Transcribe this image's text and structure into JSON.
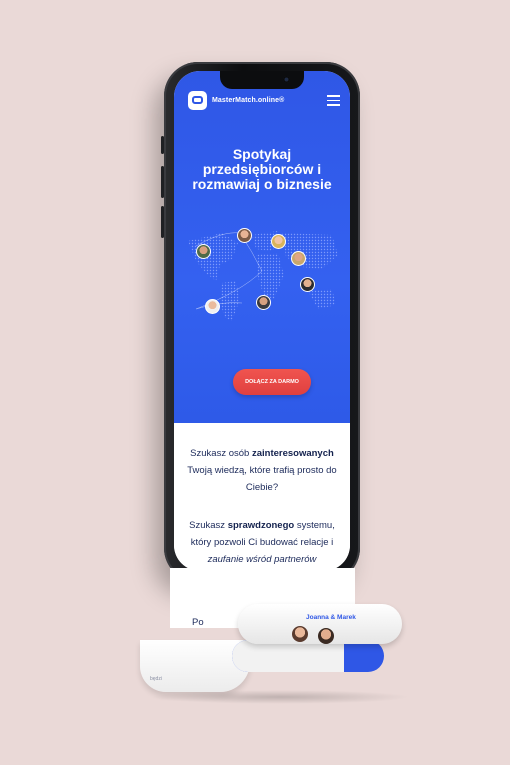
{
  "brand": {
    "name": "MasterMatch.online®"
  },
  "hero": {
    "headline": "Spotykaj przedsiębiorców i rozmawiaj o biznesie",
    "cta_label": "DOŁĄCZ ZA DARMO"
  },
  "content": {
    "p1_a": "Szukasz osób ",
    "p1_b": "zainteresowanych",
    "p1_c": " Twoją wiedzą, które trafią prosto do Ciebie?",
    "p2_a": "Szukasz ",
    "p2_b": "sprawdzonego",
    "p2_c": " systemu, który pozwoli Ci budować relacje i ",
    "p2_d": "zaufanie wśród partnerów biznesowych?",
    "paper_fragment": "Po",
    "small_fragment": "będzi"
  },
  "roll": {
    "names": "Joanna & Marek"
  },
  "colors": {
    "primary": "#2f57e6",
    "cta": "#e0403f",
    "background": "#ead9d7",
    "text": "#1c2a5a"
  },
  "icons": [
    "logo-icon",
    "hamburger-menu-icon",
    "world-map-graphic"
  ]
}
